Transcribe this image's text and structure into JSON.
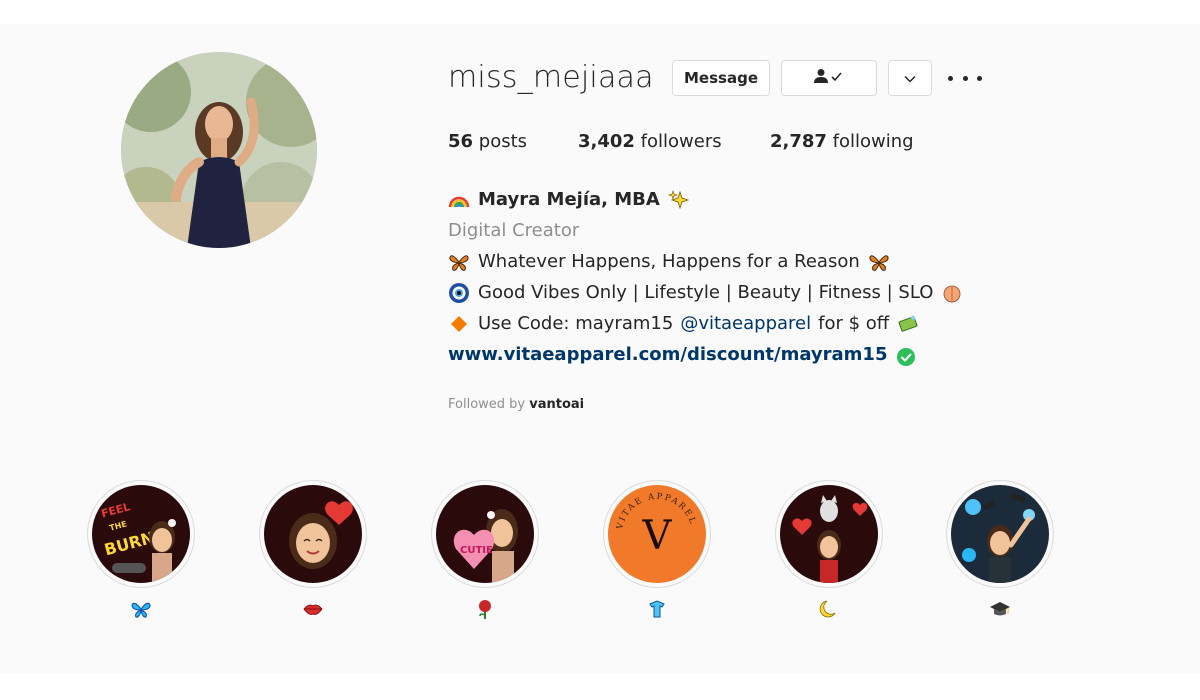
{
  "profile": {
    "username": "miss_mejiaaa",
    "buttons": {
      "message_label": "Message",
      "follow_icon": "person-check-icon",
      "chevron_icon": "chevron-down-icon",
      "more_icon": "more-options-icon"
    },
    "stats": {
      "posts_count": "56",
      "posts_label": "posts",
      "followers_count": "3,402",
      "followers_label": "followers",
      "following_count": "2,787",
      "following_label": "following"
    },
    "bio": {
      "name": "Mayra Mejía, MBA",
      "category": "Digital Creator",
      "line1": "Whatever Happens, Happens for a Reason",
      "line2": "Good Vibes Only | Lifestyle | Beauty | Fitness | SLO",
      "line3_prefix": "Use Code: mayram15",
      "line3_mention": "@vitaeapparel",
      "line3_suffix": "for $ off",
      "link": "www.vitaeapparel.com/discount/mayram15"
    },
    "followed_by": {
      "prefix": "Followed by",
      "user": "vantoai"
    }
  },
  "highlights": [
    {
      "label_icon": "butterfly-icon",
      "cover": "feel-the-burn-bitmoji"
    },
    {
      "label_icon": "lips-icon",
      "cover": "heart-bitmoji"
    },
    {
      "label_icon": "rose-icon",
      "cover": "cutie-bitmoji"
    },
    {
      "label_icon": "hanger-icon",
      "cover": "vitae-apparel-logo"
    },
    {
      "label_icon": "moon-icon",
      "cover": "cat-hearts-bitmoji"
    },
    {
      "label_icon": "graduation-cap-icon",
      "cover": "graduation-bitmoji"
    }
  ],
  "logo_text": {
    "vitae_ring": "VITAE APPAREL",
    "vitae_letter": "V",
    "burn_text": "FEEL THE BURN!",
    "cutie_text": "CUTIE"
  },
  "colors": {
    "link": "#00376b",
    "secondary_text": "#8e8e8e",
    "vitae_orange": "#f07a2a",
    "verified_green": "#2dbd5a"
  }
}
